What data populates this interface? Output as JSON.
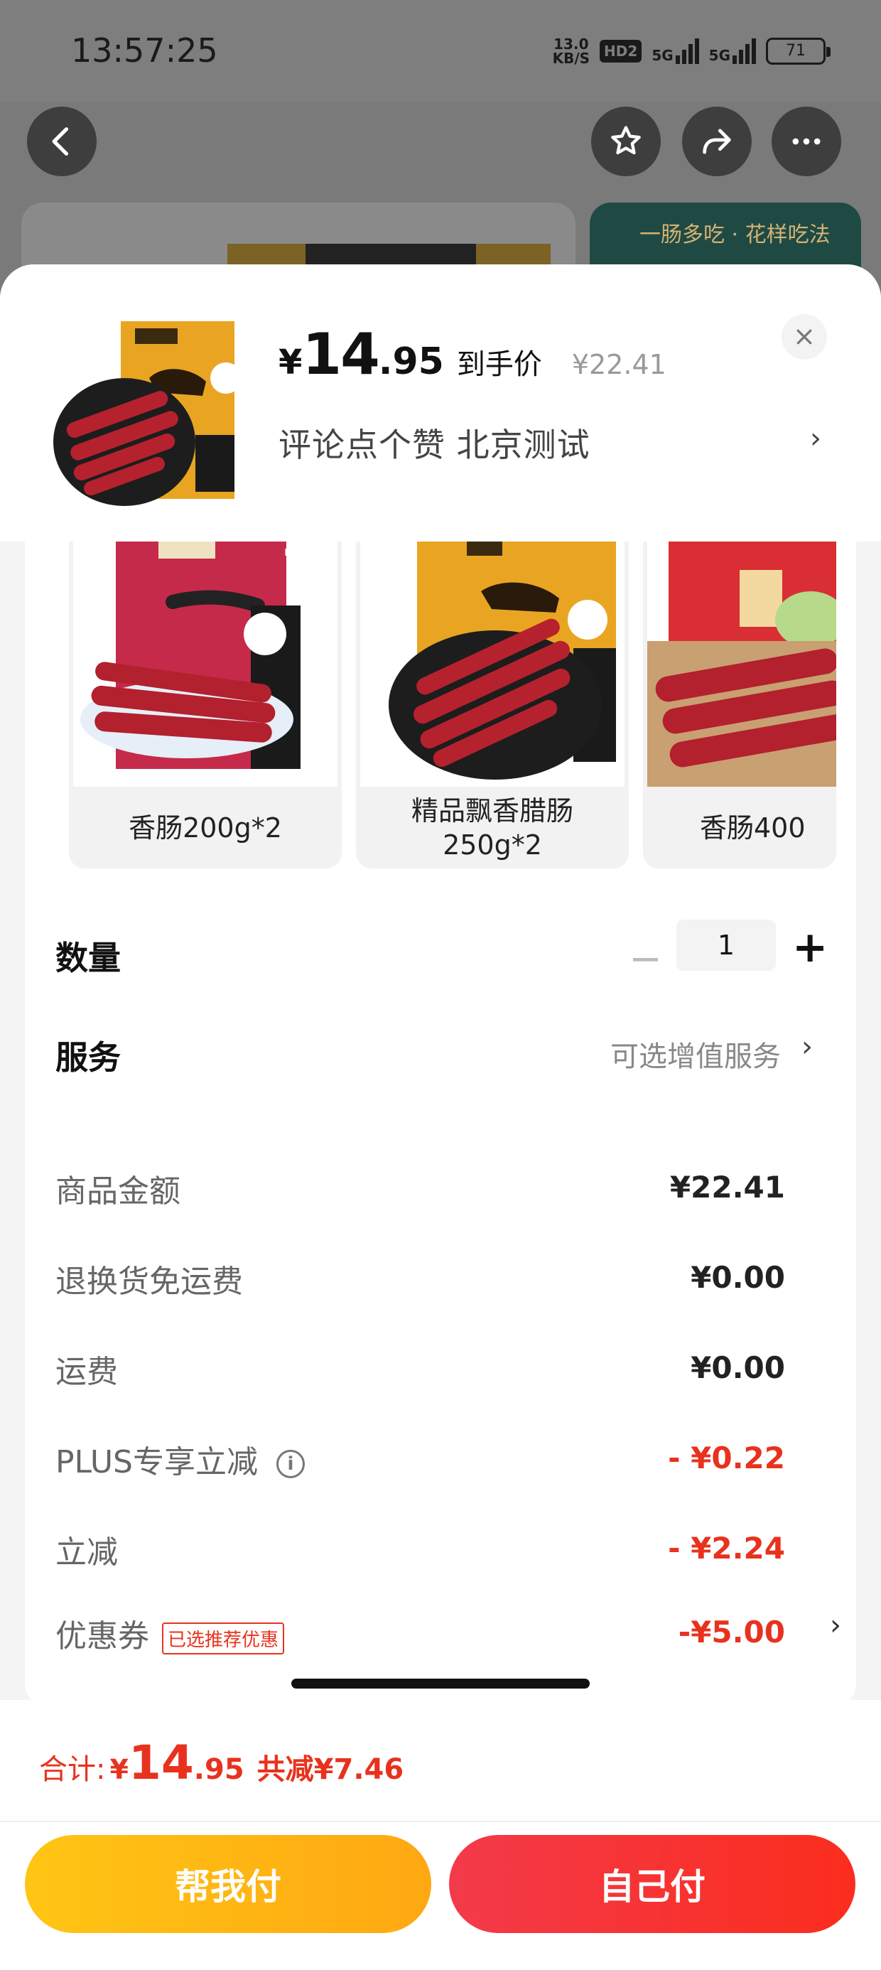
{
  "status_bar": {
    "time": "13:57:25",
    "net_speed": "13.0",
    "net_unit": "KB/S",
    "hd": "HD2",
    "sig1": "5G",
    "sig2": "5G",
    "battery": "71"
  },
  "nav": {
    "back_icon": "chevron-left-icon",
    "favorite_icon": "star-icon",
    "share_icon": "share-icon",
    "more_icon": "more-icon"
  },
  "background": {
    "banner_text": "一肠多吃 · 花样吃法"
  },
  "product": {
    "price_currency": "¥",
    "price_int": "14",
    "price_dec": ".95",
    "price_tag": "到手价",
    "original_price": "¥22.41",
    "selected_desc": "评论点个赞  北京测试"
  },
  "variants": [
    {
      "label": "香肠200g*2"
    },
    {
      "label": "精品飘香腊肠\n250g*2"
    },
    {
      "label": "香肠400"
    }
  ],
  "quantity": {
    "label": "数量",
    "value": "1",
    "minus": "−",
    "plus": "+"
  },
  "service": {
    "label": "服务",
    "value": "可选增值服务"
  },
  "breakdown": {
    "rows": [
      {
        "label": "商品金额",
        "value": "¥22.41"
      },
      {
        "label": "退换货免运费",
        "value": "¥0.00"
      },
      {
        "label": "运费",
        "value": "¥0.00"
      },
      {
        "label": "PLUS专享立减",
        "value": "- ¥0.22"
      },
      {
        "label": "立减",
        "value": "- ¥2.24"
      },
      {
        "label": "优惠券",
        "value": "-¥5.00"
      }
    ],
    "coupon_tag": "已选推荐优惠"
  },
  "footer": {
    "total_label": "合计:",
    "total_currency": "¥",
    "total_int": "14",
    "total_dec": ".95",
    "saved": "共减¥7.46",
    "help_pay": "帮我付",
    "self_pay": "自己付"
  },
  "colors": {
    "accent_red": "#e8321e",
    "help_pay_yellow": "#ffb813",
    "self_pay_red": "#f5333a"
  }
}
